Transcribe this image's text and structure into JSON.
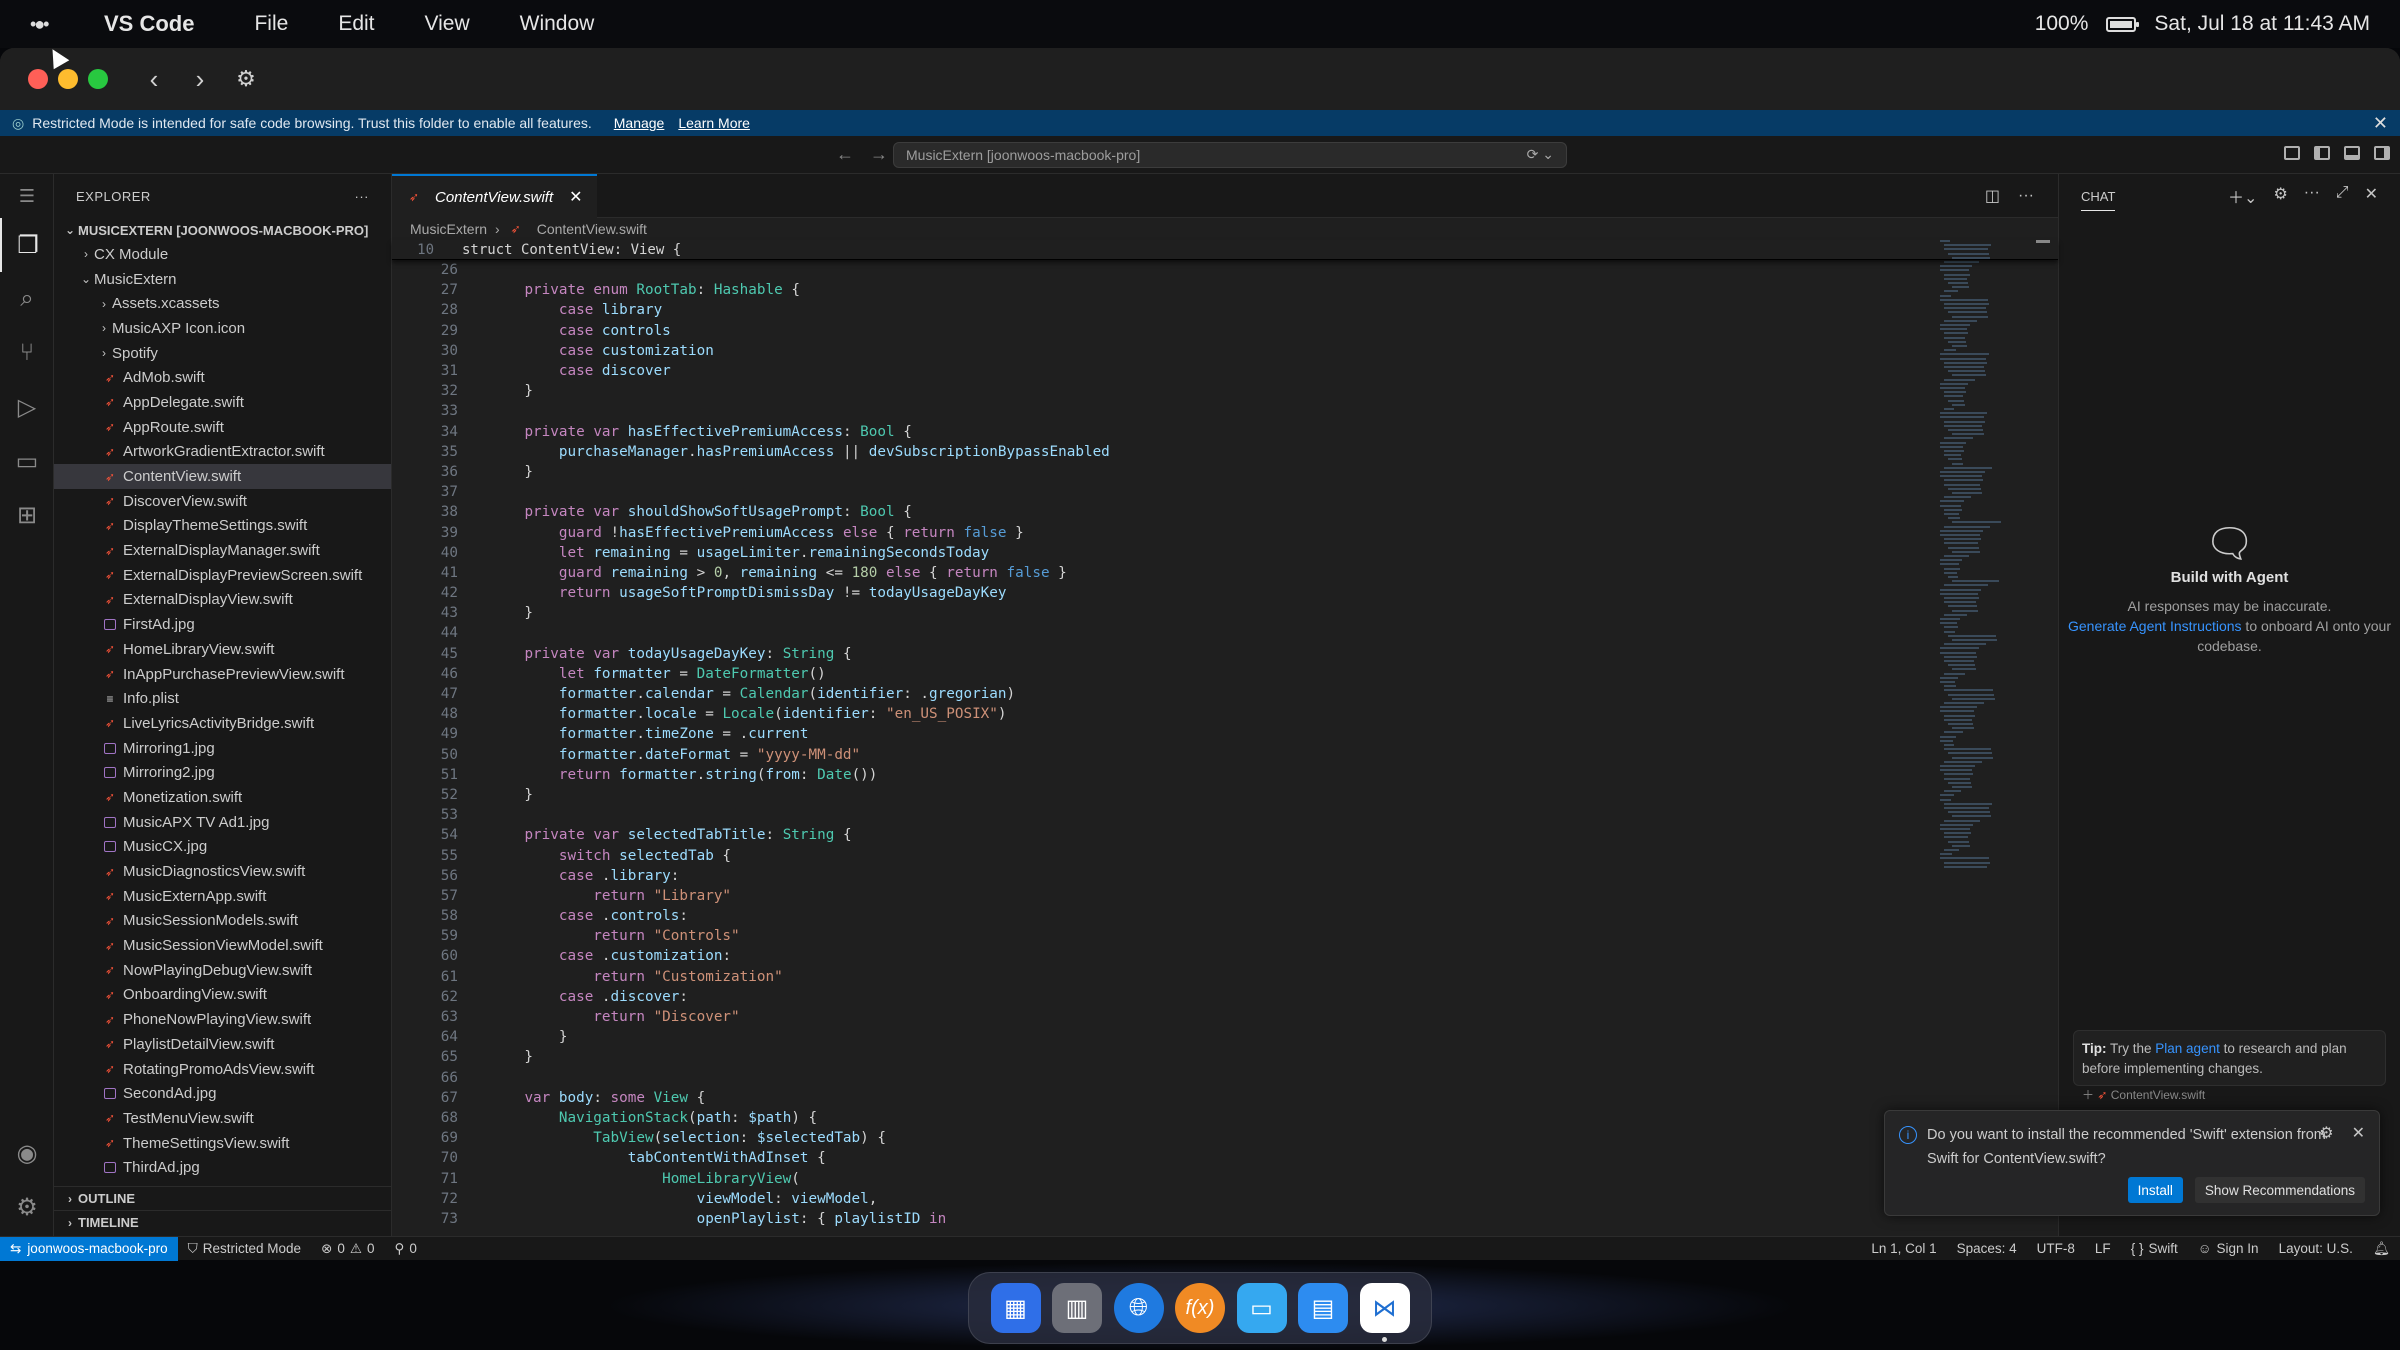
{
  "menubar": {
    "app_name": "VS Code",
    "menus": [
      "File",
      "Edit",
      "View",
      "Window"
    ],
    "battery": "100%",
    "datetime": "Sat, Jul 18 at 11:43 AM"
  },
  "banner": {
    "text": "Restricted Mode is intended for safe code browsing. Trust this folder to enable all features.",
    "manage": "Manage",
    "learn_more": "Learn More"
  },
  "command_center": {
    "text": "MusicExtern [joonwoos-macbook-pro]"
  },
  "explorer": {
    "title": "EXPLORER",
    "root": "MUSICEXTERN [JOONWOOS-MACBOOK-PRO]",
    "items": [
      {
        "label": "CX Module",
        "type": "folder",
        "depth": 1,
        "expanded": false
      },
      {
        "label": "MusicExtern",
        "type": "folder",
        "depth": 1,
        "expanded": true
      },
      {
        "label": "Assets.xcassets",
        "type": "folder",
        "depth": 2,
        "expanded": false
      },
      {
        "label": "MusicAXP Icon.icon",
        "type": "folder",
        "depth": 2,
        "expanded": false
      },
      {
        "label": "Spotify",
        "type": "folder",
        "depth": 2,
        "expanded": false
      },
      {
        "label": "AdMob.swift",
        "type": "swift",
        "depth": 2
      },
      {
        "label": "AppDelegate.swift",
        "type": "swift",
        "depth": 2
      },
      {
        "label": "AppRoute.swift",
        "type": "swift",
        "depth": 2
      },
      {
        "label": "ArtworkGradientExtractor.swift",
        "type": "swift",
        "depth": 2
      },
      {
        "label": "ContentView.swift",
        "type": "swift",
        "depth": 2,
        "selected": true
      },
      {
        "label": "DiscoverView.swift",
        "type": "swift",
        "depth": 2
      },
      {
        "label": "DisplayThemeSettings.swift",
        "type": "swift",
        "depth": 2
      },
      {
        "label": "ExternalDisplayManager.swift",
        "type": "swift",
        "depth": 2
      },
      {
        "label": "ExternalDisplayPreviewScreen.swift",
        "type": "swift",
        "depth": 2
      },
      {
        "label": "ExternalDisplayView.swift",
        "type": "swift",
        "depth": 2
      },
      {
        "label": "FirstAd.jpg",
        "type": "image",
        "depth": 2
      },
      {
        "label": "HomeLibraryView.swift",
        "type": "swift",
        "depth": 2
      },
      {
        "label": "InAppPurchasePreviewView.swift",
        "type": "swift",
        "depth": 2
      },
      {
        "label": "Info.plist",
        "type": "plist",
        "depth": 2
      },
      {
        "label": "LiveLyricsActivityBridge.swift",
        "type": "swift",
        "depth": 2
      },
      {
        "label": "Mirroring1.jpg",
        "type": "image",
        "depth": 2
      },
      {
        "label": "Mirroring2.jpg",
        "type": "image",
        "depth": 2
      },
      {
        "label": "Monetization.swift",
        "type": "swift",
        "depth": 2
      },
      {
        "label": "MusicAPX TV Ad1.jpg",
        "type": "image",
        "depth": 2
      },
      {
        "label": "MusicCX.jpg",
        "type": "image",
        "depth": 2
      },
      {
        "label": "MusicDiagnosticsView.swift",
        "type": "swift",
        "depth": 2
      },
      {
        "label": "MusicExternApp.swift",
        "type": "swift",
        "depth": 2
      },
      {
        "label": "MusicSessionModels.swift",
        "type": "swift",
        "depth": 2
      },
      {
        "label": "MusicSessionViewModel.swift",
        "type": "swift",
        "depth": 2
      },
      {
        "label": "NowPlayingDebugView.swift",
        "type": "swift",
        "depth": 2
      },
      {
        "label": "OnboardingView.swift",
        "type": "swift",
        "depth": 2
      },
      {
        "label": "PhoneNowPlayingView.swift",
        "type": "swift",
        "depth": 2
      },
      {
        "label": "PlaylistDetailView.swift",
        "type": "swift",
        "depth": 2
      },
      {
        "label": "RotatingPromoAdsView.swift",
        "type": "swift",
        "depth": 2
      },
      {
        "label": "SecondAd.jpg",
        "type": "image",
        "depth": 2
      },
      {
        "label": "TestMenuView.swift",
        "type": "swift",
        "depth": 2
      },
      {
        "label": "ThemeSettingsView.swift",
        "type": "swift",
        "depth": 2
      },
      {
        "label": "ThirdAd.jpg",
        "type": "image",
        "depth": 2
      }
    ],
    "outline": "OUTLINE",
    "timeline": "TIMELINE"
  },
  "editor": {
    "tab_label": "ContentView.swift",
    "breadcrumb": [
      "MusicExtern",
      "ContentView.swift"
    ],
    "sticky": {
      "num": "10",
      "text": "struct ContentView: View {"
    },
    "lines": [
      {
        "n": "26",
        "t": ""
      },
      {
        "n": "27",
        "t": "    private enum RootTab: Hashable {"
      },
      {
        "n": "28",
        "t": "        case library"
      },
      {
        "n": "29",
        "t": "        case controls"
      },
      {
        "n": "30",
        "t": "        case customization"
      },
      {
        "n": "31",
        "t": "        case discover"
      },
      {
        "n": "32",
        "t": "    }"
      },
      {
        "n": "33",
        "t": ""
      },
      {
        "n": "34",
        "t": "    private var hasEffectivePremiumAccess: Bool {"
      },
      {
        "n": "35",
        "t": "        purchaseManager.hasPremiumAccess || devSubscriptionBypassEnabled"
      },
      {
        "n": "36",
        "t": "    }"
      },
      {
        "n": "37",
        "t": ""
      },
      {
        "n": "38",
        "t": "    private var shouldShowSoftUsagePrompt: Bool {"
      },
      {
        "n": "39",
        "t": "        guard !hasEffectivePremiumAccess else { return false }"
      },
      {
        "n": "40",
        "t": "        let remaining = usageLimiter.remainingSecondsToday"
      },
      {
        "n": "41",
        "t": "        guard remaining > 0, remaining <= 180 else { return false }"
      },
      {
        "n": "42",
        "t": "        return usageSoftPromptDismissDay != todayUsageDayKey"
      },
      {
        "n": "43",
        "t": "    }"
      },
      {
        "n": "44",
        "t": ""
      },
      {
        "n": "45",
        "t": "    private var todayUsageDayKey: String {"
      },
      {
        "n": "46",
        "t": "        let formatter = DateFormatter()"
      },
      {
        "n": "47",
        "t": "        formatter.calendar = Calendar(identifier: .gregorian)"
      },
      {
        "n": "48",
        "t": "        formatter.locale = Locale(identifier: \"en_US_POSIX\")"
      },
      {
        "n": "49",
        "t": "        formatter.timeZone = .current"
      },
      {
        "n": "50",
        "t": "        formatter.dateFormat = \"yyyy-MM-dd\""
      },
      {
        "n": "51",
        "t": "        return formatter.string(from: Date())"
      },
      {
        "n": "52",
        "t": "    }"
      },
      {
        "n": "53",
        "t": ""
      },
      {
        "n": "54",
        "t": "    private var selectedTabTitle: String {"
      },
      {
        "n": "55",
        "t": "        switch selectedTab {"
      },
      {
        "n": "56",
        "t": "        case .library:"
      },
      {
        "n": "57",
        "t": "            return \"Library\""
      },
      {
        "n": "58",
        "t": "        case .controls:"
      },
      {
        "n": "59",
        "t": "            return \"Controls\""
      },
      {
        "n": "60",
        "t": "        case .customization:"
      },
      {
        "n": "61",
        "t": "            return \"Customization\""
      },
      {
        "n": "62",
        "t": "        case .discover:"
      },
      {
        "n": "63",
        "t": "            return \"Discover\""
      },
      {
        "n": "64",
        "t": "        }"
      },
      {
        "n": "65",
        "t": "    }"
      },
      {
        "n": "66",
        "t": ""
      },
      {
        "n": "67",
        "t": "    var body: some View {"
      },
      {
        "n": "68",
        "t": "        NavigationStack(path: $path) {"
      },
      {
        "n": "69",
        "t": "            TabView(selection: $selectedTab) {"
      },
      {
        "n": "70",
        "t": "                tabContentWithAdInset {"
      },
      {
        "n": "71",
        "t": "                    HomeLibraryView("
      },
      {
        "n": "72",
        "t": "                        viewModel: viewModel,"
      },
      {
        "n": "73",
        "t": "                        openPlaylist: { playlistID in"
      }
    ]
  },
  "chat": {
    "title": "CHAT",
    "empty_title": "Build with Agent",
    "empty_line1": "AI responses may be inaccurate.",
    "empty_link": "Generate Agent Instructions",
    "empty_line2_after": " to onboard AI onto your codebase.",
    "tip_label": "Tip:",
    "tip_pre": " Try the ",
    "tip_link": "Plan agent",
    "tip_post": " to research and plan before implementing changes.",
    "context_file": "ContentView.swift"
  },
  "toast": {
    "message": "Do you want to install the recommended 'Swift' extension from Swift for ContentView.swift?",
    "install": "Install",
    "show_recs": "Show Recommendations"
  },
  "statusbar": {
    "remote": "joonwoos-macbook-pro",
    "restricted": "Restricted Mode",
    "errors": "0",
    "warnings": "0",
    "ports": "0",
    "position": "Ln 1, Col 1",
    "spaces": "Spaces: 4",
    "encoding": "UTF-8",
    "eol": "LF",
    "language": "Swift",
    "sign_in": "Sign In",
    "layout": "Layout: U.S."
  }
}
